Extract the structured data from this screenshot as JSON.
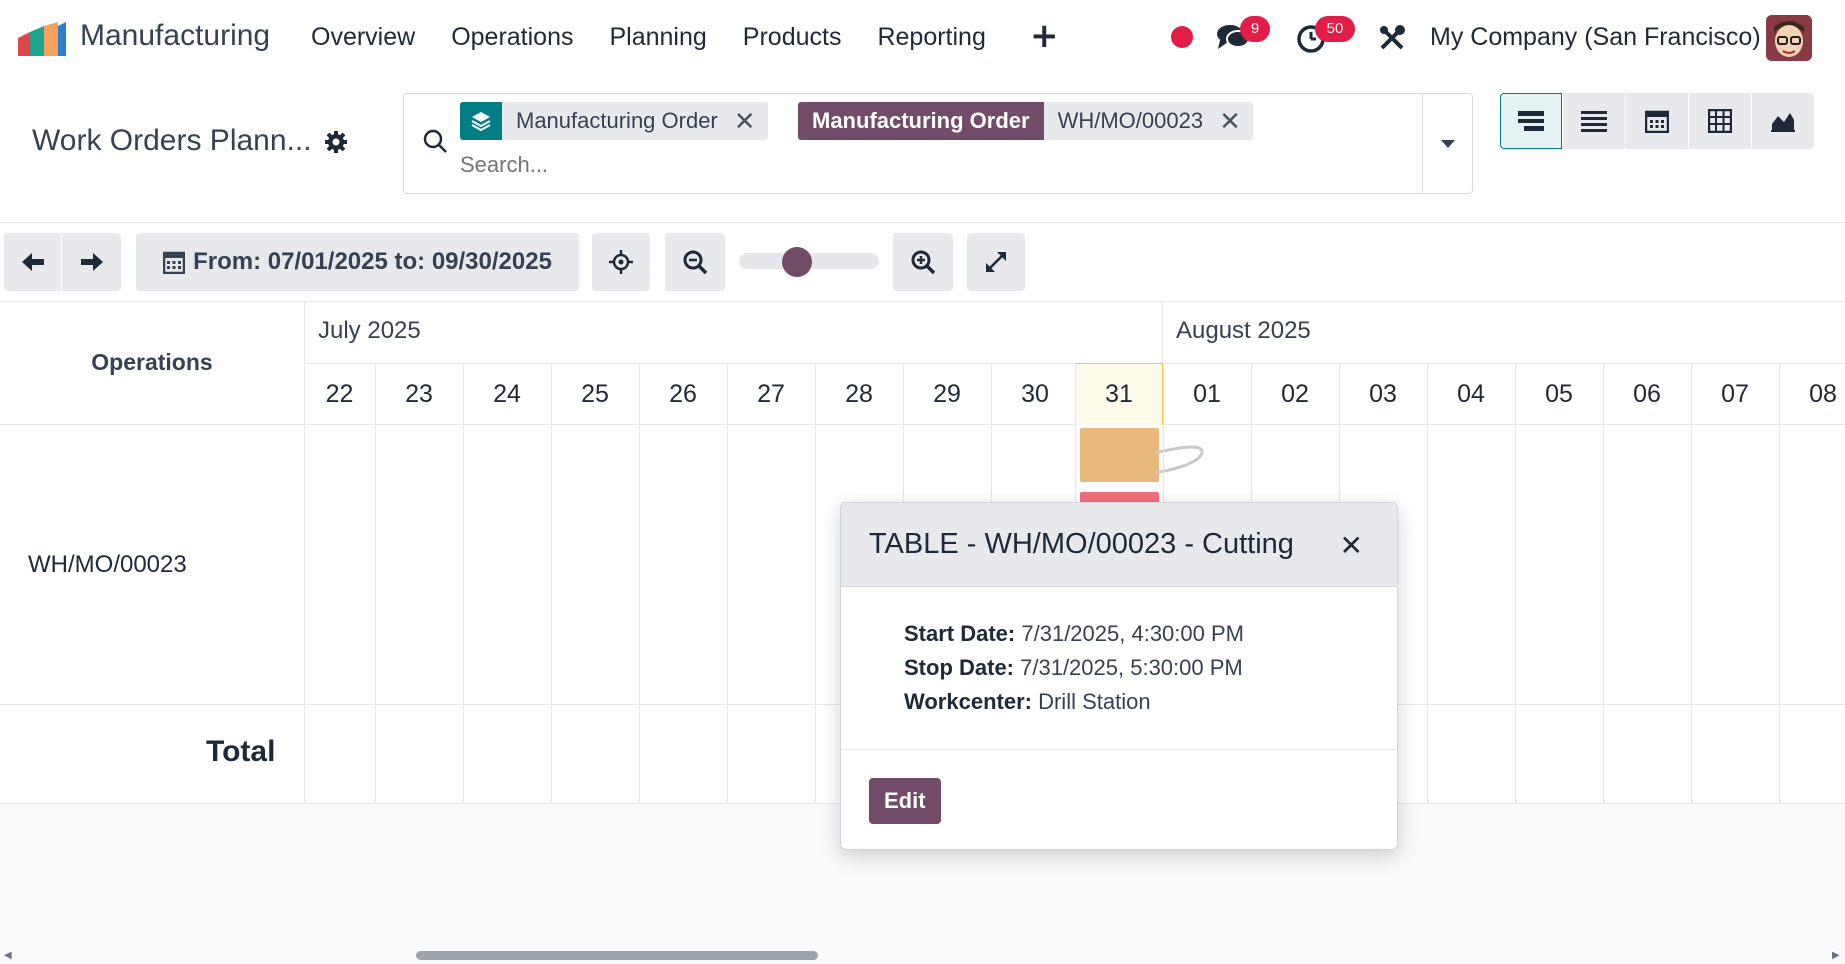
{
  "app": {
    "name": "Manufacturing"
  },
  "nav": {
    "items": [
      "Overview",
      "Operations",
      "Planning",
      "Products",
      "Reporting"
    ],
    "messages_count": "9",
    "activities_count": "50",
    "company": "My Company (San Francisco)"
  },
  "control_panel": {
    "breadcrumb": "Work Orders Plann...",
    "facet1_value": "Manufacturing Order",
    "facet2_label": "Manufacturing Order",
    "facet2_value": "WH/MO/00023",
    "search_placeholder": "Search..."
  },
  "toolbar": {
    "range": "From: 07/01/2025 to: 09/30/2025"
  },
  "gantt": {
    "ops_header": "Operations",
    "months": [
      "July 2025",
      "August 2025"
    ],
    "days": [
      "22",
      "23",
      "24",
      "25",
      "26",
      "27",
      "28",
      "29",
      "30",
      "31",
      "01",
      "02",
      "03",
      "04",
      "05",
      "06",
      "07",
      "08"
    ],
    "today": "31",
    "rows": [
      {
        "label": "WH/MO/00023"
      }
    ],
    "total_label": "Total"
  },
  "popover": {
    "title": "TABLE - WH/MO/00023 - Cutting",
    "start_label": "Start Date:",
    "start_value": "7/31/2025, 4:30:00 PM",
    "stop_label": "Stop Date:",
    "stop_value": "7/31/2025, 5:30:00 PM",
    "workcenter_label": "Workcenter:",
    "workcenter_value": "Drill Station",
    "edit_label": "Edit"
  },
  "colors": {
    "brand": "#714b67",
    "teal": "#017e84",
    "badge": "#e11d48",
    "pill_orange": "#e9b87c",
    "pill_red": "#f0717d"
  }
}
